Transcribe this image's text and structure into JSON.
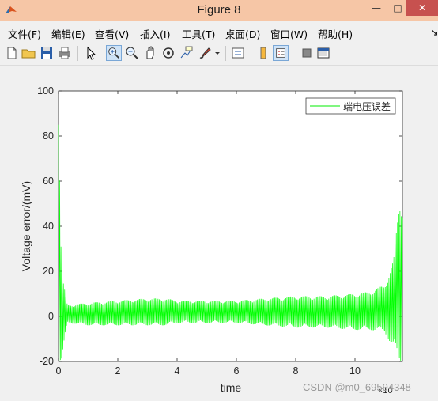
{
  "window": {
    "title": "Figure 8",
    "minimize": "—",
    "maximize": "□",
    "close": "✕"
  },
  "menu": [
    "文件(F)",
    "编辑(E)",
    "查看(V)",
    "插入(I)",
    "工具(T)",
    "桌面(D)",
    "窗口(W)",
    "帮助(H)"
  ],
  "menu_overflow": "↘",
  "toolbar": [
    "new-file-icon",
    "open-folder-icon",
    "save-icon",
    "print-icon",
    "pointer-icon",
    "zoom-in-icon",
    "zoom-out-icon",
    "pan-icon",
    "rotate-3d-icon",
    "data-cursor-icon",
    "brush-icon",
    "link-plot-icon",
    "colorbar-icon",
    "legend-icon",
    "hide-plot-tools-icon",
    "show-plot-tools-icon"
  ],
  "watermark": "CSDN @m0_69594348",
  "chart_data": {
    "type": "line",
    "title": "",
    "xlabel": "time",
    "ylabel": "Voltage error/(mV)",
    "x_multiplier": "×10",
    "xlim": [
      0,
      11.6
    ],
    "ylim": [
      -20,
      100
    ],
    "xticks": [
      "0",
      "2",
      "4",
      "6",
      "8",
      "10"
    ],
    "yticks": [
      "-20",
      "0",
      "20",
      "40",
      "60",
      "80",
      "100"
    ],
    "legend": {
      "position": "top-right",
      "entries": [
        "端电压误差"
      ]
    },
    "series": [
      {
        "name": "端电压误差",
        "color": "#00ff00",
        "envelope": {
          "x": [
            0,
            0.05,
            0.1,
            0.3,
            1,
            2,
            3,
            3.6,
            4,
            5,
            6,
            7,
            8,
            9,
            10,
            10.5,
            11,
            11.3,
            11.5,
            11.6
          ],
          "upper": [
            100,
            62,
            20,
            5,
            6,
            7,
            8,
            8,
            7,
            7,
            7,
            8,
            9,
            9,
            10,
            11,
            14,
            25,
            52,
            52
          ],
          "lower": [
            -20,
            -20,
            -20,
            -3,
            -4,
            -4,
            -4,
            -4,
            -3,
            -3,
            -3,
            -4,
            -5,
            -5,
            -6,
            -6,
            -7,
            -15,
            -20,
            -20
          ]
        },
        "oscillation_count": 280
      }
    ]
  }
}
